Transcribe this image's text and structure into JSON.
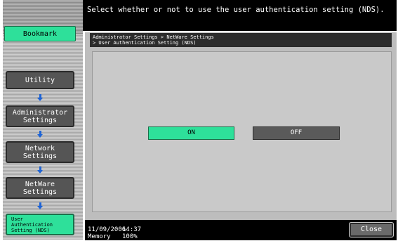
{
  "header": {
    "message": "Select whether or not to use the user authentication setting (NDS)."
  },
  "sidebar": {
    "bookmark_label": "Bookmark",
    "items": [
      {
        "label": "Utility"
      },
      {
        "label_lines": [
          "Administrator",
          "Settings"
        ]
      },
      {
        "label_lines": [
          "Network",
          "Settings"
        ]
      },
      {
        "label_lines": [
          "NetWare",
          "Settings"
        ]
      },
      {
        "label_lines": [
          "User",
          "Authentication",
          "Setting (NDS)"
        ]
      }
    ]
  },
  "breadcrumb": {
    "line1": "Administrator Settings > NetWare Settings",
    "line2": "> User Authentication Setting (NDS)"
  },
  "options": {
    "on_label": "ON",
    "off_label": "OFF",
    "selected": "ON"
  },
  "footer": {
    "date": "11/09/2006",
    "time": "14:37",
    "memory_label": "Memory",
    "memory_value": "100%",
    "close_label": "Close"
  },
  "colors": {
    "accent_green": "#2ee09a",
    "dark_button": "#5a5a5a",
    "arrow_blue": "#1d63d6"
  }
}
